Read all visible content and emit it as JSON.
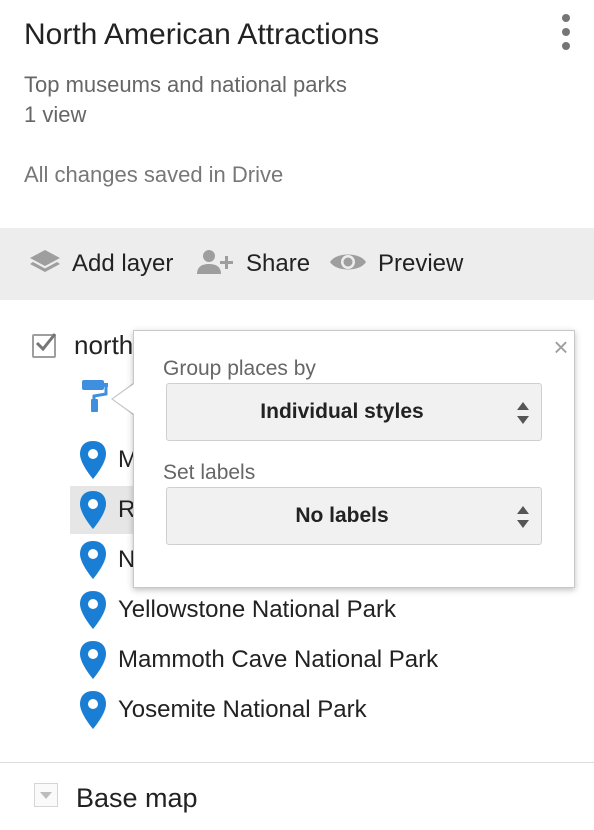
{
  "header": {
    "title": "North American Attractions",
    "description": "Top museums and national parks",
    "views": "1 view",
    "save_status": "All changes saved in Drive"
  },
  "toolbar": {
    "add_layer": "Add layer",
    "share": "Share",
    "preview": "Preview"
  },
  "layer": {
    "name": "north",
    "checked": true,
    "places": [
      {
        "label": "M",
        "selected": false
      },
      {
        "label": "R",
        "selected": true
      },
      {
        "label": "N",
        "selected": false
      },
      {
        "label": "Yellowstone National Park",
        "selected": false
      },
      {
        "label": "Mammoth Cave National Park",
        "selected": false
      },
      {
        "label": "Yosemite National Park",
        "selected": false
      }
    ]
  },
  "style_popup": {
    "group_label": "Group places by",
    "group_value": "Individual styles",
    "labels_label": "Set labels",
    "labels_value": "No labels",
    "close": "×"
  },
  "base_map": {
    "label": "Base map"
  },
  "colors": {
    "pin": "#1a7fd4",
    "toolbar_bg": "#ededed",
    "selected_row": "#e6e6e6"
  }
}
